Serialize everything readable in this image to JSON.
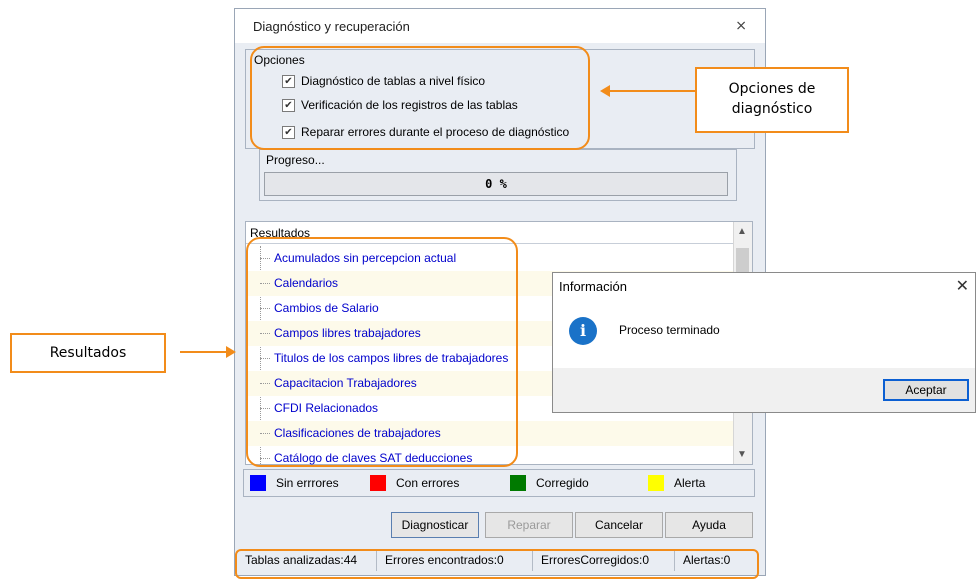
{
  "dialog": {
    "title": "Diagnóstico y recuperación",
    "close_icon": "close-icon"
  },
  "options": {
    "label": "Opciones",
    "items": [
      {
        "label": "Diagnóstico de  tablas a nivel físico",
        "checked": true
      },
      {
        "label": "Verificación de los registros de las tablas",
        "checked": true
      },
      {
        "label": "Reparar errores durante el proceso de diagnóstico",
        "checked": true
      }
    ]
  },
  "progress": {
    "label": "Progreso...",
    "value_text": "0 %",
    "value": 0
  },
  "results": {
    "header": "Resultados",
    "items": [
      "Acumulados sin percepcion actual",
      "Calendarios",
      "Cambios de Salario",
      "Campos libres trabajadores",
      "Titulos de los campos libres de trabajadores",
      "Capacitacion Trabajadores",
      "CFDI Relacionados",
      "Clasificaciones de trabajadores",
      "Catálogo de claves SAT deducciones"
    ]
  },
  "legend": [
    {
      "label": "Sin errrores",
      "color": "#0000ff"
    },
    {
      "label": "Con errores",
      "color": "#ff0000"
    },
    {
      "label": "Corregido",
      "color": "#007a00"
    },
    {
      "label": "Alerta",
      "color": "#ffff00"
    }
  ],
  "buttons": {
    "diagnosticar": "Diagnosticar",
    "reparar": "Reparar",
    "cancelar": "Cancelar",
    "ayuda": "Ayuda"
  },
  "status": {
    "tablas": "Tablas analizadas:44",
    "errores": "Errores encontrados:0",
    "corregidos": "ErroresCorregidos:0",
    "alertas": "Alertas:0"
  },
  "info_dialog": {
    "title": "Información",
    "message": "Proceso terminado",
    "accept": "Aceptar",
    "icon": "info-icon"
  },
  "annotations": {
    "options_callout": "Opciones de diagnóstico",
    "results_callout": "Resultados",
    "accent_color": "#f28c1a"
  }
}
